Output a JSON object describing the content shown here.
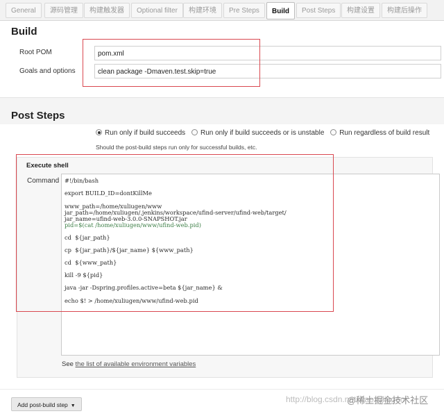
{
  "tabs": [
    "General",
    "源码管理",
    "构建触发器",
    "Optional filter",
    "构建环境",
    "Pre Steps",
    "Build",
    "Post Steps",
    "构建设置",
    "构建后操作"
  ],
  "build": {
    "title": "Build",
    "root_pom_label": "Root POM",
    "root_pom_value": "pom.xml",
    "goals_label": "Goals and options",
    "goals_value": "clean package -Dmaven.test.skip=true"
  },
  "post_steps": {
    "title": "Post Steps",
    "options": [
      {
        "label": "Run only if build succeeds",
        "checked": true
      },
      {
        "label": "Run only if build succeeds or is unstable",
        "checked": false
      },
      {
        "label": "Run regardless of build result",
        "checked": false
      }
    ],
    "hint": "Should the post-build steps run only for successful builds, etc."
  },
  "execute_shell": {
    "title": "Execute shell",
    "command_label": "Command",
    "lines": [
      "#!/bin/bash",
      "export BUILD_ID=dontKillMe",
      "www_path=/home/xuliugen/www",
      "jar_path=/home/xuliugen/.jenkins/workspace/ufind-server/ufind-web/target/",
      "jar_name=ufind-web-3.0.0-SNAPSHOT.jar",
      "pid=$(cat /home/xuliugen/www/ufind-web.pid)",
      "cd  ${jar_path}",
      "cp  ${jar_path}/${jar_name} ${www_path}",
      "cd  ${www_path}",
      "kill -9 ${pid}",
      "java -jar -Dspring.profiles.active=beta ${jar_name} &",
      "echo $! > /home/xuliugen/www/ufind-web.pid"
    ]
  },
  "env_note": {
    "prefix": "See ",
    "link": "the list of available environment variables"
  },
  "add_post_build_step": "Add post-build step",
  "watermark": "http://blog.csdn.net/xiaoxuliugen",
  "watermark_brand": "@稀土掘金技术社区"
}
